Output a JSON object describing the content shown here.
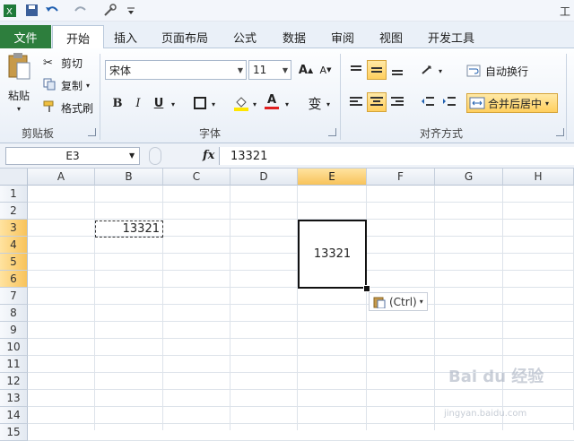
{
  "quick_access": {
    "title": "工"
  },
  "tabs": [
    "文件",
    "开始",
    "插入",
    "页面布局",
    "公式",
    "数据",
    "审阅",
    "视图",
    "开发工具"
  ],
  "clipboard": {
    "paste": "粘贴",
    "cut": "剪切",
    "copy": "复制",
    "format_painter": "格式刷",
    "group": "剪贴板"
  },
  "font": {
    "name": "宋体",
    "size": "11",
    "grow": "A",
    "shrink": "A",
    "bold": "B",
    "italic": "I",
    "underline": "U",
    "font_color": "A",
    "wen": "变",
    "group": "字体"
  },
  "alignment": {
    "wrap_text": "自动换行",
    "merge_center": "合并后居中",
    "group": "对齐方式"
  },
  "formula_bar": {
    "name_box": "E3",
    "fx": "fx",
    "content": "13321"
  },
  "grid": {
    "columns": [
      "A",
      "B",
      "C",
      "D",
      "E",
      "F",
      "G",
      "H"
    ],
    "rows": [
      "1",
      "2",
      "3",
      "4",
      "5",
      "6",
      "7",
      "8",
      "9",
      "10",
      "11",
      "12",
      "13",
      "14",
      "15"
    ],
    "selected_column": "E",
    "selected_rows": [
      "3",
      "4",
      "5",
      "6"
    ],
    "copied_cell": {
      "ref": "B3",
      "value": "13321"
    },
    "merged_cell": {
      "ref": "E3:E6",
      "value": "13321"
    }
  },
  "paste_options": {
    "label": "(Ctrl)"
  },
  "watermark": {
    "text": "Bai du 经验",
    "url": "jingyan.baidu.com"
  },
  "colors": {
    "file_tab": "#2d7e3d",
    "selection_header": "#f8c35b",
    "highlight": "#ffcf5e"
  }
}
